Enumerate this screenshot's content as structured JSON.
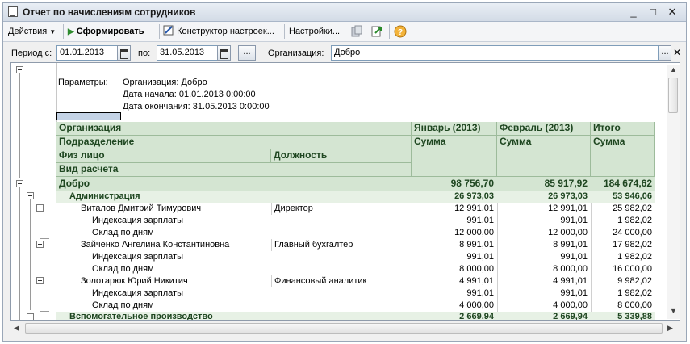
{
  "window": {
    "title": "Отчет по начислениям сотрудников",
    "controls": {
      "minimize": "_",
      "maximize": "□",
      "close": "✕"
    }
  },
  "toolbar": {
    "actions": "Действия",
    "generate": "Сформировать",
    "constructor": "Конструктор настроек...",
    "settings": "Настройки...",
    "help_icon": "help-icon"
  },
  "filter": {
    "period_label": "Период с:",
    "period_from": "01.01.2013",
    "to_label": "по:",
    "period_to": "31.05.2013",
    "dots": "...",
    "org_label": "Организация:",
    "org_value": "Добро",
    "org_dots": "..."
  },
  "params": {
    "label": "Параметры:",
    "org": "Организация: Добро",
    "date_start": "Дата начала: 01.01.2013 0:00:00",
    "date_end": "Дата окончания: 31.05.2013 0:00:00"
  },
  "headers": {
    "organization": "Организация",
    "department": "Подразделение",
    "person": "Физ лицо",
    "position": "Должность",
    "calc_type": "Вид расчета",
    "col1": "Январь (2013)",
    "col2": "Февраль (2013)",
    "col3": "Итого",
    "sum1": "Сумма",
    "sum2": "Сумма",
    "sum3": "Сумма"
  },
  "rows": [
    {
      "level": 0,
      "name": "Добро",
      "position": "",
      "v1": "98 756,70",
      "v2": "85 917,92",
      "v3": "184 674,62"
    },
    {
      "level": 1,
      "name": "Администрация",
      "position": "",
      "v1": "26 973,03",
      "v2": "26 973,03",
      "v3": "53 946,06"
    },
    {
      "level": 2,
      "name": "Виталов Дмитрий Тимурович",
      "position": "Директор",
      "v1": "12 991,01",
      "v2": "12 991,01",
      "v3": "25 982,02"
    },
    {
      "level": 3,
      "name": "Индексация зарплаты",
      "position": "",
      "v1": "991,01",
      "v2": "991,01",
      "v3": "1 982,02"
    },
    {
      "level": 3,
      "name": "Оклад по дням",
      "position": "",
      "v1": "12 000,00",
      "v2": "12 000,00",
      "v3": "24 000,00"
    },
    {
      "level": 2,
      "name": "Зайченко Ангелина Константиновна",
      "position": "Главный бухгалтер",
      "v1": "8 991,01",
      "v2": "8 991,01",
      "v3": "17 982,02"
    },
    {
      "level": 3,
      "name": "Индексация зарплаты",
      "position": "",
      "v1": "991,01",
      "v2": "991,01",
      "v3": "1 982,02"
    },
    {
      "level": 3,
      "name": "Оклад по дням",
      "position": "",
      "v1": "8 000,00",
      "v2": "8 000,00",
      "v3": "16 000,00"
    },
    {
      "level": 2,
      "name": "Золотарюк Юрий Никитич",
      "position": "Финансовый аналитик",
      "v1": "4 991,01",
      "v2": "4 991,01",
      "v3": "9 982,02"
    },
    {
      "level": 3,
      "name": "Индексация зарплаты",
      "position": "",
      "v1": "991,01",
      "v2": "991,01",
      "v3": "1 982,02"
    },
    {
      "level": 3,
      "name": "Оклад по дням",
      "position": "",
      "v1": "4 000,00",
      "v2": "4 000,00",
      "v3": "8 000,00"
    },
    {
      "level": 1,
      "name": "Вспомогательное производство",
      "position": "",
      "v1": "2 669,94",
      "v2": "2 669,94",
      "v3": "5 339,88"
    }
  ]
}
